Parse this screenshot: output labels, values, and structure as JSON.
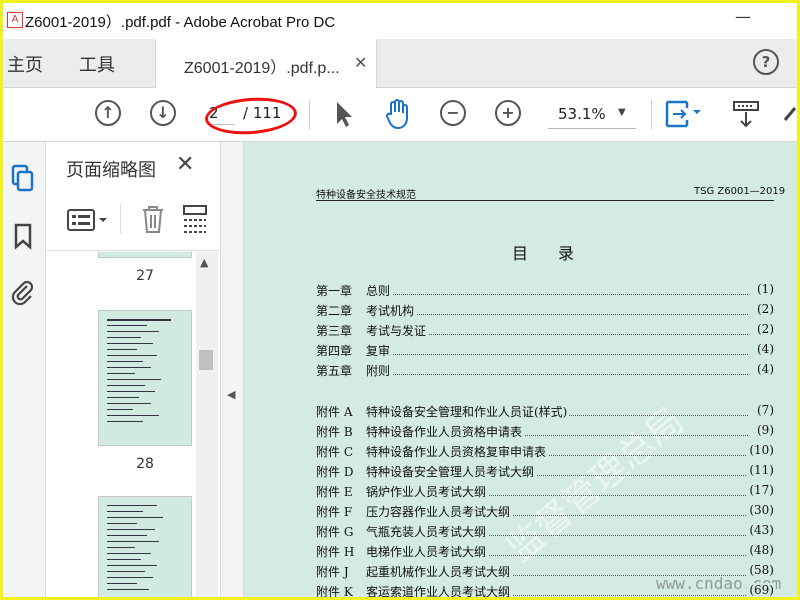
{
  "window": {
    "app_icon": "pdf-app-icon",
    "title": "Z6001-2019）.pdf.pdf - Adobe Acrobat Pro DC",
    "minimize_glyph": "—"
  },
  "tabs": {
    "home": "主页",
    "tools": "工具",
    "document": "Z6001-2019）.pdf.p...",
    "close_glyph": "✕",
    "help_glyph": "?"
  },
  "toolbar": {
    "page_current": "2",
    "page_total": "/ 111",
    "zoom": "53.1%",
    "highlight_color": "#e11111"
  },
  "thumbnails": {
    "title": "页面缩略图",
    "close_glyph": "✕",
    "pages": [
      "27",
      "28"
    ]
  },
  "document": {
    "header_left": "特种设备安全技术规范",
    "header_right": "TSG Z6001—2019",
    "toc_title": "目录",
    "toc": [
      {
        "label": "第一章",
        "text": "总则",
        "page": "(1)"
      },
      {
        "label": "第二章",
        "text": "考试机构",
        "page": "(2)"
      },
      {
        "label": "第三章",
        "text": "考试与发证",
        "page": "(2)"
      },
      {
        "label": "第四章",
        "text": "复审",
        "page": "(4)"
      },
      {
        "label": "第五章",
        "text": "附则",
        "page": "(4)"
      },
      {
        "label": "附件 A",
        "text": "特种设备安全管理和作业人员证(样式)",
        "page": "(7)"
      },
      {
        "label": "附件 B",
        "text": "特种设备作业人员资格申请表",
        "page": "(9)"
      },
      {
        "label": "附件 C",
        "text": "特种设备作业人员资格复审申请表",
        "page": "(10)"
      },
      {
        "label": "附件 D",
        "text": "特种设备安全管理人员考试大纲",
        "page": "(11)"
      },
      {
        "label": "附件 E",
        "text": "锅炉作业人员考试大纲",
        "page": "(17)"
      },
      {
        "label": "附件 F",
        "text": "压力容器作业人员考试大纲",
        "page": "(30)"
      },
      {
        "label": "附件 G",
        "text": "气瓶充装人员考试大纲",
        "page": "(43)"
      },
      {
        "label": "附件 H",
        "text": "电梯作业人员考试大纲",
        "page": "(48)"
      },
      {
        "label": "附件 J",
        "text": "起重机械作业人员考试大纲",
        "page": "(58)"
      },
      {
        "label": "附件 K",
        "text": "客运索道作业人员考试大纲",
        "page": "(69)"
      }
    ],
    "watermark": "监督管理总局",
    "site_mark": "www.cndao.com",
    "background": "#d3ebe2"
  }
}
